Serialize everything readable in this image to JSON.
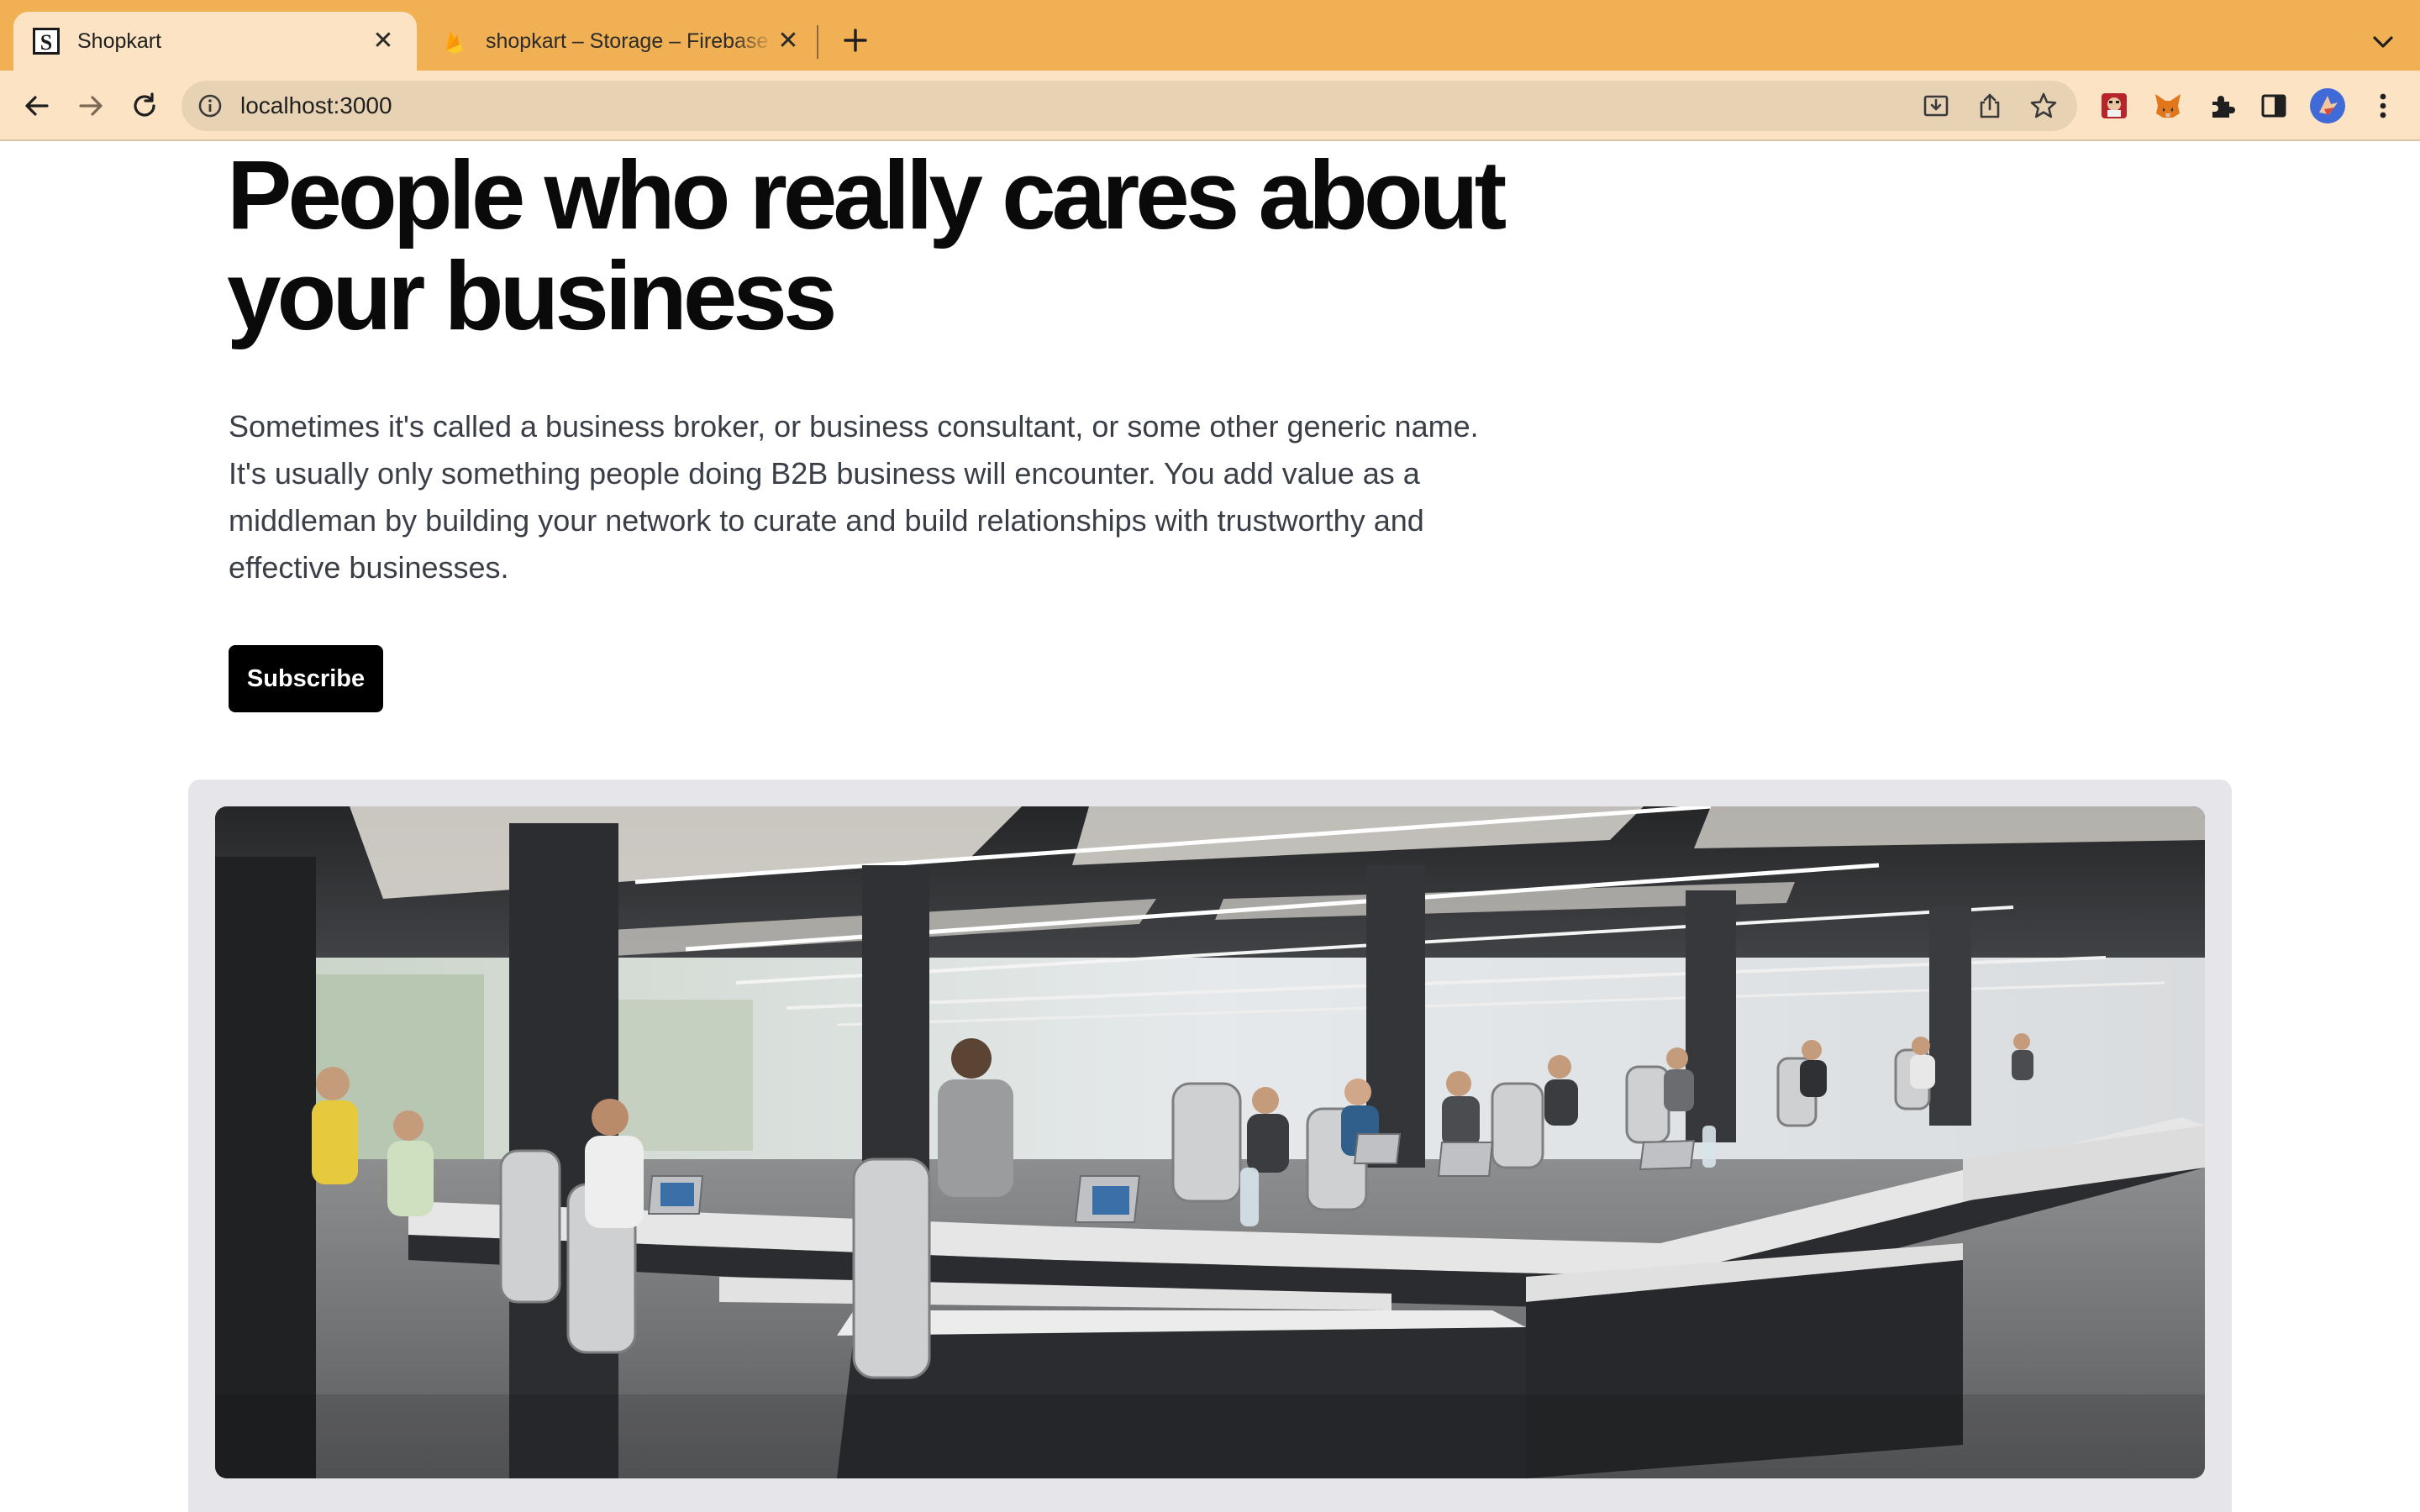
{
  "browser": {
    "tabs": [
      {
        "title": "Shopkart",
        "active": true,
        "favicon": "shopkart-logo-icon"
      },
      {
        "title": "shopkart – Storage – Firebase",
        "active": false,
        "favicon": "firebase-flame-icon"
      }
    ],
    "url": "localhost:3000",
    "accent_color": "#f1b053",
    "toolbar_color": "#fbe3c4"
  },
  "hero": {
    "headline": "People who really cares about your business",
    "description": "Sometimes it's called a business broker, or business consultant, or some other generic name. It's usually only something people doing B2B business will encounter. You add value as a middleman by building your network to curate and build relationships with trustworthy and effective businesses.",
    "subscribe_label": "Subscribe"
  },
  "image": {
    "subject": "open-plan office with rows of people working at laptops"
  }
}
